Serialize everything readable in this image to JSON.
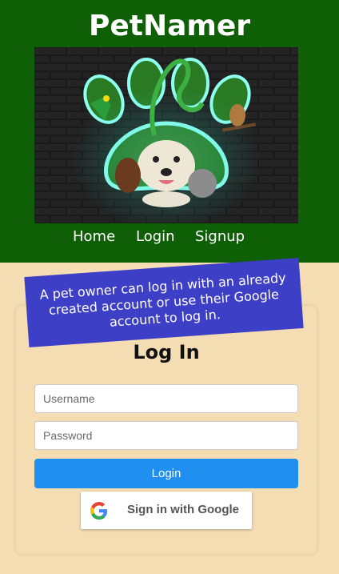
{
  "header": {
    "brand": "PetNamer",
    "nav": [
      {
        "label": "Home"
      },
      {
        "label": "Login"
      },
      {
        "label": "Signup"
      }
    ]
  },
  "note": {
    "text": "A pet owner can log in with an already created account or use their Google account to log in."
  },
  "login": {
    "title": "Log In",
    "username_placeholder": "Username",
    "password_placeholder": "Password",
    "login_button": "Login",
    "google_button": "Sign in with Google"
  },
  "colors": {
    "header_bg": "#0f5f07",
    "page_bg": "#f5deb3",
    "note_bg": "#3d3fc7",
    "login_button": "#1f8ff0"
  }
}
